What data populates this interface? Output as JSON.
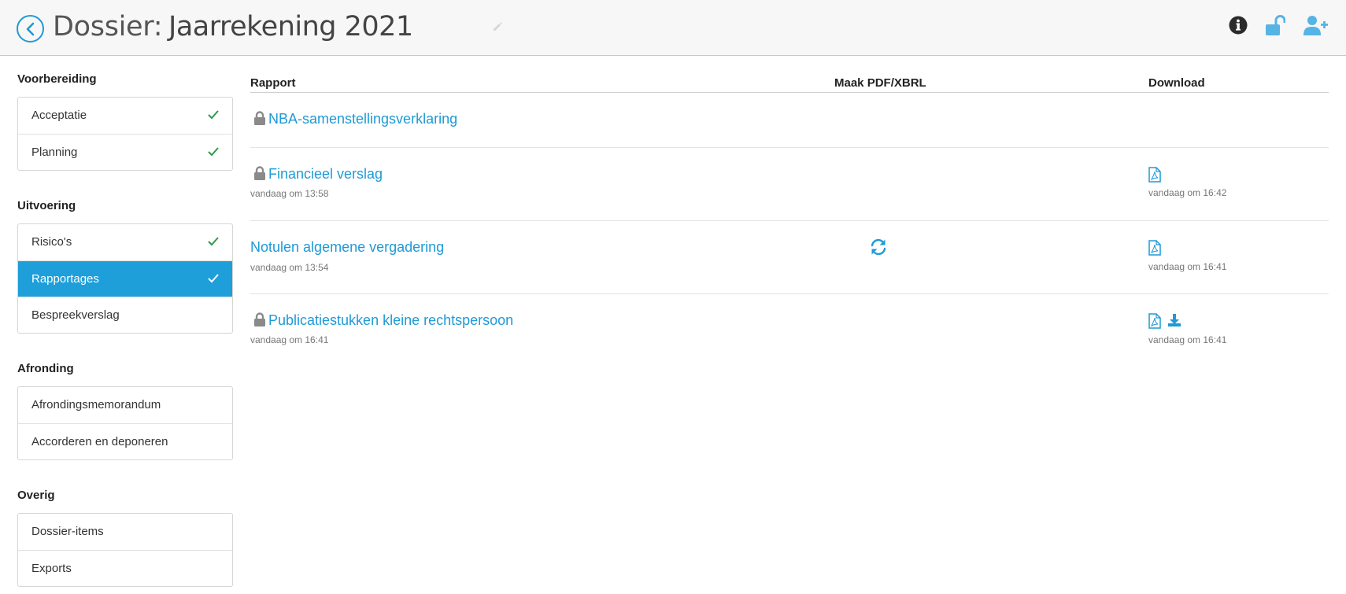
{
  "header": {
    "label": "Dossier:",
    "title": "Jaarrekening 2021",
    "icons": [
      "info-icon",
      "unlock-icon",
      "add-user-icon"
    ],
    "accent": "#1f9ad6"
  },
  "sidebar": {
    "sections": [
      {
        "title": "Voorbereiding",
        "items": [
          {
            "label": "Acceptatie",
            "checked": true
          },
          {
            "label": "Planning",
            "checked": true
          }
        ]
      },
      {
        "title": "Uitvoering",
        "items": [
          {
            "label": "Risico's",
            "checked": true
          },
          {
            "label": "Rapportages",
            "checked": true,
            "active": true
          },
          {
            "label": "Bespreekverslag",
            "checked": false
          }
        ]
      },
      {
        "title": "Afronding",
        "items": [
          {
            "label": "Afrondingsmemorandum",
            "checked": false
          },
          {
            "label": "Accorderen en deponeren",
            "checked": false
          }
        ]
      },
      {
        "title": "Overig",
        "items": [
          {
            "label": "Dossier-items",
            "checked": false
          },
          {
            "label": "Exports",
            "checked": false
          }
        ]
      }
    ]
  },
  "table": {
    "headers": {
      "report": "Rapport",
      "make": "Maak PDF/XBRL",
      "download": "Download"
    },
    "rows": [
      {
        "name": "NBA-samenstellingsverklaring",
        "locked": true,
        "date": "",
        "sync": false,
        "pdf": false,
        "download": false,
        "download_date": ""
      },
      {
        "name": "Financieel verslag",
        "locked": true,
        "date": "vandaag om 13:58",
        "sync": false,
        "pdf": true,
        "download": false,
        "download_date": "vandaag om 16:42"
      },
      {
        "name": "Notulen algemene vergadering",
        "locked": false,
        "date": "vandaag om 13:54",
        "sync": true,
        "pdf": true,
        "download": false,
        "download_date": "vandaag om 16:41"
      },
      {
        "name": "Publicatiestukken kleine rechtspersoon",
        "locked": true,
        "date": "vandaag om 16:41",
        "sync": false,
        "pdf": true,
        "download": true,
        "download_date": "vandaag om 16:41"
      }
    ]
  }
}
